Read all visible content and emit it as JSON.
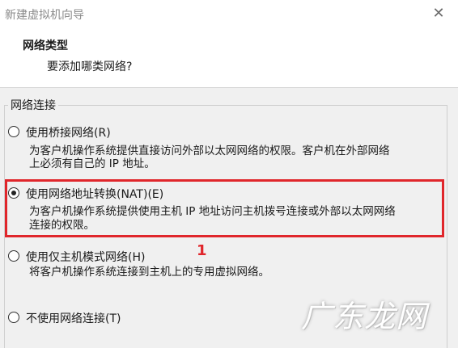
{
  "window": {
    "title": "新建虚拟机向导",
    "close_glyph": "✕"
  },
  "header": {
    "title": "网络类型",
    "subtitle": "要添加哪类网络?"
  },
  "group": {
    "label": "网络连接"
  },
  "options": [
    {
      "label": "使用桥接网络(R)",
      "checked": false,
      "description": [
        "为客户机操作系统提供直接访问外部以太网网络的权限。客户机在外部网络",
        "上必须有自己的 IP 地址。"
      ]
    },
    {
      "label": "使用网络地址转换(NAT)(E)",
      "checked": true,
      "description": [
        "为客户机操作系统提供使用主机 IP 地址访问主机拨号连接或外部以太网网络",
        "连接的权限。"
      ]
    },
    {
      "label": "使用仅主机模式网络(H)",
      "checked": false,
      "description": [
        "将客户机操作系统连接到主机上的专用虚拟网络。"
      ]
    },
    {
      "label": "不使用网络连接(T)",
      "checked": false,
      "description": []
    }
  ],
  "annotation": {
    "marker": "1",
    "color": "#e0262b"
  },
  "watermark": "广东龙网"
}
